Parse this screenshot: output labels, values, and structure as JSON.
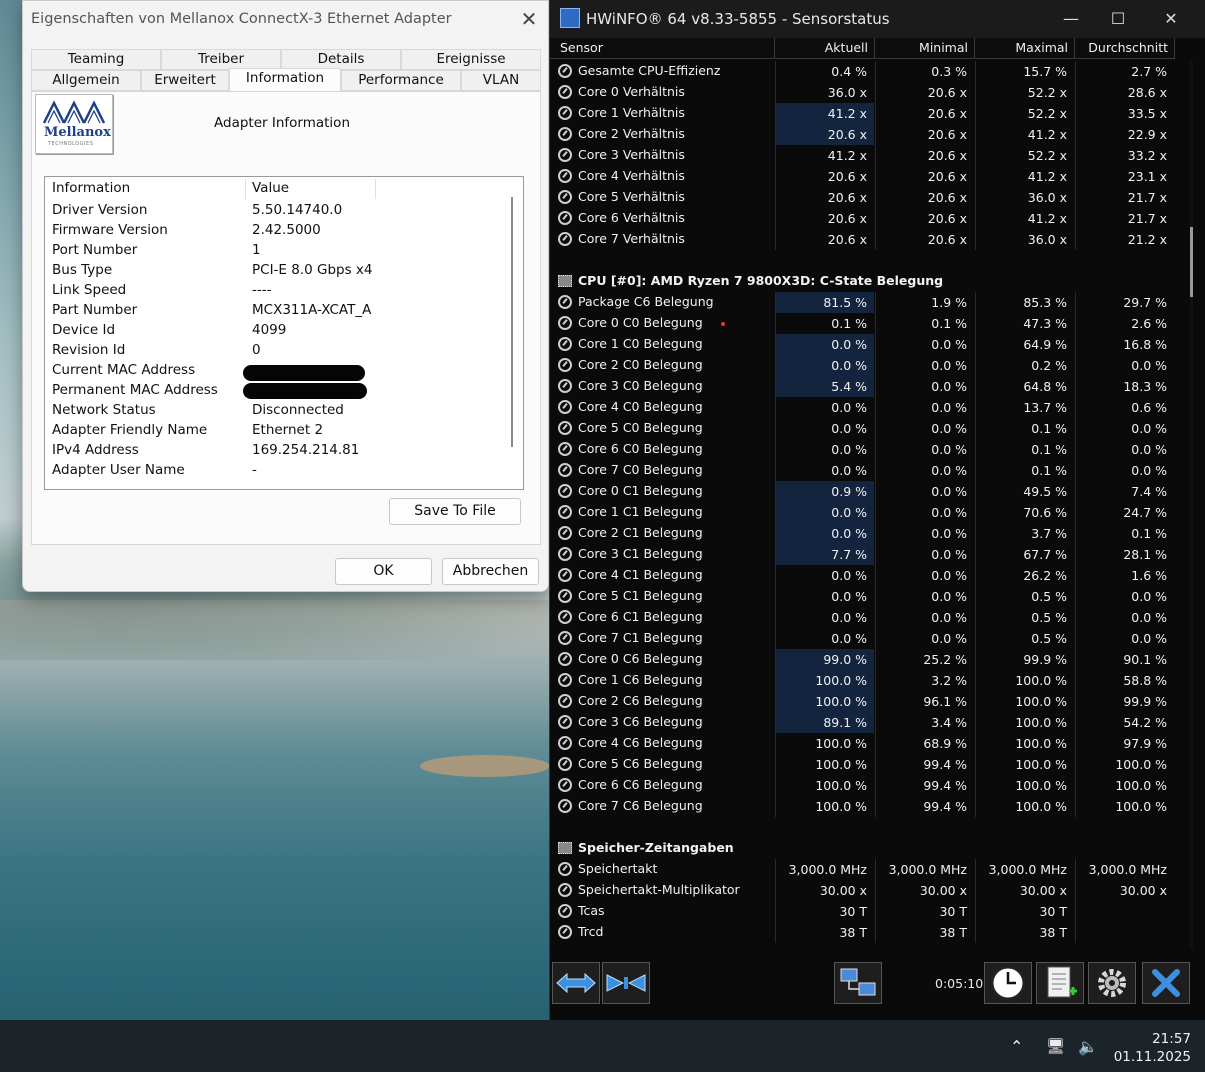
{
  "dialog": {
    "title": "Eigenschaften von Mellanox ConnectX-3 Ethernet Adapter",
    "tabs_row1": [
      "Teaming",
      "Treiber",
      "Details",
      "Ereignisse"
    ],
    "tabs_row2": [
      "Allgemein",
      "Erweitert",
      "Information",
      "Performance",
      "VLAN"
    ],
    "active_tab": "Information",
    "logo_text": "Mellanox",
    "logo_sub": "TECHNOLOGIES",
    "section_label": "Adapter Information",
    "list_headers": [
      "Information",
      "Value"
    ],
    "list": [
      {
        "key": "Driver Version",
        "value": "5.50.14740.0"
      },
      {
        "key": "Firmware Version",
        "value": "2.42.5000"
      },
      {
        "key": "Port Number",
        "value": "1"
      },
      {
        "key": "Bus Type",
        "value": "PCI-E 8.0 Gbps x4"
      },
      {
        "key": "Link Speed",
        "value": "----"
      },
      {
        "key": "Part Number",
        "value": "MCX311A-XCAT_A"
      },
      {
        "key": "Device Id",
        "value": "4099"
      },
      {
        "key": "Revision Id",
        "value": "0"
      },
      {
        "key": "Current MAC Address",
        "value": ""
      },
      {
        "key": "Permanent MAC Address",
        "value": ""
      },
      {
        "key": "Network Status",
        "value": "Disconnected"
      },
      {
        "key": "Adapter Friendly Name",
        "value": "Ethernet 2"
      },
      {
        "key": "IPv4 Address",
        "value": "169.254.214.81"
      },
      {
        "key": "Adapter User Name",
        "value": "-"
      }
    ],
    "save_button": "Save To File",
    "ok_button": "OK",
    "cancel_button": "Abbrechen"
  },
  "hwinfo": {
    "title": "HWiNFO® 64 v8.33-5855 - Sensorstatus",
    "headers": [
      "Sensor",
      "Aktuell",
      "Minimal",
      "Maximal",
      "Durchschnitt"
    ],
    "rows": [
      {
        "type": "s",
        "name": "Gesamte CPU-Effizienz",
        "v": [
          "0.4 %",
          "0.3 %",
          "15.7 %",
          "2.7 %"
        ],
        "hl": false
      },
      {
        "type": "s",
        "name": "Core 0 Verhältnis",
        "v": [
          "36.0 x",
          "20.6 x",
          "52.2 x",
          "28.6 x"
        ],
        "hl": false
      },
      {
        "type": "s",
        "name": "Core 1 Verhältnis",
        "v": [
          "41.2 x",
          "20.6 x",
          "52.2 x",
          "33.5 x"
        ],
        "hl": true
      },
      {
        "type": "s",
        "name": "Core 2 Verhältnis",
        "v": [
          "20.6 x",
          "20.6 x",
          "41.2 x",
          "22.9 x"
        ],
        "hl": true
      },
      {
        "type": "s",
        "name": "Core 3 Verhältnis",
        "v": [
          "41.2 x",
          "20.6 x",
          "52.2 x",
          "33.2 x"
        ],
        "hl": false
      },
      {
        "type": "s",
        "name": "Core 4 Verhältnis",
        "v": [
          "20.6 x",
          "20.6 x",
          "41.2 x",
          "23.1 x"
        ],
        "hl": false
      },
      {
        "type": "s",
        "name": "Core 5 Verhältnis",
        "v": [
          "20.6 x",
          "20.6 x",
          "36.0 x",
          "21.7 x"
        ],
        "hl": false
      },
      {
        "type": "s",
        "name": "Core 6 Verhältnis",
        "v": [
          "20.6 x",
          "20.6 x",
          "41.2 x",
          "21.7 x"
        ],
        "hl": false
      },
      {
        "type": "s",
        "name": "Core 7 Verhältnis",
        "v": [
          "20.6 x",
          "20.6 x",
          "36.0 x",
          "21.2 x"
        ],
        "hl": false
      },
      {
        "type": "blank"
      },
      {
        "type": "h",
        "name": "CPU [#0]: AMD Ryzen 7 9800X3D: C-State Belegung"
      },
      {
        "type": "s",
        "name": "Package C6 Belegung",
        "v": [
          "81.5 %",
          "1.9 %",
          "85.3 %",
          "29.7 %"
        ],
        "hl": true
      },
      {
        "type": "s",
        "name": "Core 0 C0 Belegung",
        "v": [
          "0.1 %",
          "0.1 %",
          "47.3 %",
          "2.6 %"
        ],
        "hl": false
      },
      {
        "type": "s",
        "name": "Core 1 C0 Belegung",
        "v": [
          "0.0 %",
          "0.0 %",
          "64.9 %",
          "16.8 %"
        ],
        "hl": true
      },
      {
        "type": "s",
        "name": "Core 2 C0 Belegung",
        "v": [
          "0.0 %",
          "0.0 %",
          "0.2 %",
          "0.0 %"
        ],
        "hl": true
      },
      {
        "type": "s",
        "name": "Core 3 C0 Belegung",
        "v": [
          "5.4 %",
          "0.0 %",
          "64.8 %",
          "18.3 %"
        ],
        "hl": true
      },
      {
        "type": "s",
        "name": "Core 4 C0 Belegung",
        "v": [
          "0.0 %",
          "0.0 %",
          "13.7 %",
          "0.6 %"
        ],
        "hl": false
      },
      {
        "type": "s",
        "name": "Core 5 C0 Belegung",
        "v": [
          "0.0 %",
          "0.0 %",
          "0.1 %",
          "0.0 %"
        ],
        "hl": false
      },
      {
        "type": "s",
        "name": "Core 6 C0 Belegung",
        "v": [
          "0.0 %",
          "0.0 %",
          "0.1 %",
          "0.0 %"
        ],
        "hl": false
      },
      {
        "type": "s",
        "name": "Core 7 C0 Belegung",
        "v": [
          "0.0 %",
          "0.0 %",
          "0.1 %",
          "0.0 %"
        ],
        "hl": false
      },
      {
        "type": "s",
        "name": "Core 0 C1 Belegung",
        "v": [
          "0.9 %",
          "0.0 %",
          "49.5 %",
          "7.4 %"
        ],
        "hl": true
      },
      {
        "type": "s",
        "name": "Core 1 C1 Belegung",
        "v": [
          "0.0 %",
          "0.0 %",
          "70.6 %",
          "24.7 %"
        ],
        "hl": true
      },
      {
        "type": "s",
        "name": "Core 2 C1 Belegung",
        "v": [
          "0.0 %",
          "0.0 %",
          "3.7 %",
          "0.1 %"
        ],
        "hl": true
      },
      {
        "type": "s",
        "name": "Core 3 C1 Belegung",
        "v": [
          "7.7 %",
          "0.0 %",
          "67.7 %",
          "28.1 %"
        ],
        "hl": true
      },
      {
        "type": "s",
        "name": "Core 4 C1 Belegung",
        "v": [
          "0.0 %",
          "0.0 %",
          "26.2 %",
          "1.6 %"
        ],
        "hl": false
      },
      {
        "type": "s",
        "name": "Core 5 C1 Belegung",
        "v": [
          "0.0 %",
          "0.0 %",
          "0.5 %",
          "0.0 %"
        ],
        "hl": false
      },
      {
        "type": "s",
        "name": "Core 6 C1 Belegung",
        "v": [
          "0.0 %",
          "0.0 %",
          "0.5 %",
          "0.0 %"
        ],
        "hl": false
      },
      {
        "type": "s",
        "name": "Core 7 C1 Belegung",
        "v": [
          "0.0 %",
          "0.0 %",
          "0.5 %",
          "0.0 %"
        ],
        "hl": false
      },
      {
        "type": "s",
        "name": "Core 0 C6 Belegung",
        "v": [
          "99.0 %",
          "25.2 %",
          "99.9 %",
          "90.1 %"
        ],
        "hl": true
      },
      {
        "type": "s",
        "name": "Core 1 C6 Belegung",
        "v": [
          "100.0 %",
          "3.2 %",
          "100.0 %",
          "58.8 %"
        ],
        "hl": true
      },
      {
        "type": "s",
        "name": "Core 2 C6 Belegung",
        "v": [
          "100.0 %",
          "96.1 %",
          "100.0 %",
          "99.9 %"
        ],
        "hl": true
      },
      {
        "type": "s",
        "name": "Core 3 C6 Belegung",
        "v": [
          "89.1 %",
          "3.4 %",
          "100.0 %",
          "54.2 %"
        ],
        "hl": true
      },
      {
        "type": "s",
        "name": "Core 4 C6 Belegung",
        "v": [
          "100.0 %",
          "68.9 %",
          "100.0 %",
          "97.9 %"
        ],
        "hl": false
      },
      {
        "type": "s",
        "name": "Core 5 C6 Belegung",
        "v": [
          "100.0 %",
          "99.4 %",
          "100.0 %",
          "100.0 %"
        ],
        "hl": false
      },
      {
        "type": "s",
        "name": "Core 6 C6 Belegung",
        "v": [
          "100.0 %",
          "99.4 %",
          "100.0 %",
          "100.0 %"
        ],
        "hl": false
      },
      {
        "type": "s",
        "name": "Core 7 C6 Belegung",
        "v": [
          "100.0 %",
          "99.4 %",
          "100.0 %",
          "100.0 %"
        ],
        "hl": false
      },
      {
        "type": "blank"
      },
      {
        "type": "h",
        "name": "Speicher-Zeitangaben"
      },
      {
        "type": "s",
        "name": "Speichertakt",
        "v": [
          "3,000.0 MHz",
          "3,000.0 MHz",
          "3,000.0 MHz",
          "3,000.0 MHz"
        ],
        "hl": false
      },
      {
        "type": "s",
        "name": "Speichertakt-Multiplikator",
        "v": [
          "30.00 x",
          "30.00 x",
          "30.00 x",
          "30.00 x"
        ],
        "hl": false
      },
      {
        "type": "s",
        "name": "Tcas",
        "v": [
          "30 T",
          "30 T",
          "30 T",
          ""
        ],
        "hl": false
      },
      {
        "type": "s",
        "name": "Trcd",
        "v": [
          "38 T",
          "38 T",
          "38 T",
          ""
        ],
        "hl": false
      }
    ],
    "timer": "0:05:10",
    "highlight_color": "#13243f"
  },
  "taskbar": {
    "time": "21:57",
    "date": "01.11.2025"
  }
}
